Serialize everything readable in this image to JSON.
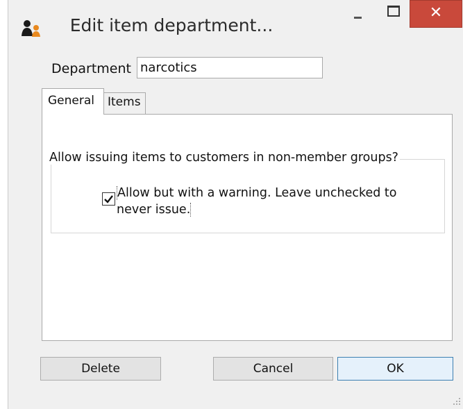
{
  "window": {
    "title": "Edit item department...",
    "close_glyph": "✕",
    "icons": {
      "app": "people-icon",
      "minimize": "minimize-icon",
      "maximize": "maximize-icon",
      "close": "close-icon"
    },
    "colors": {
      "close_button": "#c9493b",
      "window_bg": "#f0f0f0",
      "ok_border": "#3c7fb1"
    }
  },
  "form": {
    "department_label": "Department",
    "department_value": "narcotics"
  },
  "tabs": [
    {
      "label": "General",
      "selected": true
    },
    {
      "label": "Items",
      "selected": false
    }
  ],
  "general": {
    "group_title": "Allow issuing items to customers in non-member groups?",
    "checkbox_label": "Allow but with a warning. Leave unchecked to never issue.",
    "checkbox_checked": true
  },
  "buttons": {
    "delete": "Delete",
    "cancel": "Cancel",
    "ok": "OK"
  }
}
